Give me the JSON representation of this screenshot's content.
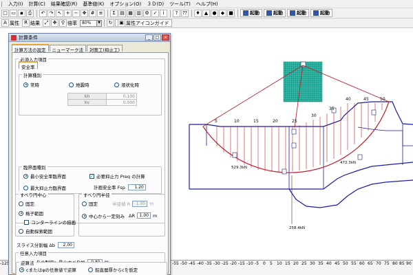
{
  "menubar": {
    "items": [
      "入力(I)",
      "計算(C)",
      "結果確認(R)",
      "基準値(K)",
      "オプション(O)",
      "３Ｄ(D)",
      "ツール(T)",
      "ヘルプ(H)"
    ]
  },
  "toolbar": {
    "launch_buttons": [
      "起動",
      "起動",
      "起動",
      "起動"
    ],
    "attr_label": "属性",
    "result_label": "結果",
    "zoom_label": "倍率",
    "zoom_value": "80%",
    "guide_label": "属性アイコンガイド"
  },
  "dialog": {
    "title": "計算条件",
    "tabs": [
      "計算方法の設定",
      "ニューマーク法",
      "対策工(抑止工)"
    ],
    "required_group": "必須入力項目",
    "safety_tab": "安全率",
    "calc_type_group": "計算種別",
    "calc_types": [
      "常時",
      "地震時",
      "液状化時"
    ],
    "kh_label": "kh",
    "kh_value": "0.100",
    "kv_label": "kv",
    "kv_value": "0.000",
    "critical_group": "臨界面種別",
    "critical_min_sf": "最小安全率臨界面",
    "critical_max_force": "最大抑止力臨界面",
    "need_force_label": "必要抑止力 Preq の計算",
    "plan_sf_label": "計画安全率 Fsp",
    "plan_sf_value": "1.20",
    "slip_center_group": "すべり円中心",
    "center_fixed": "固定",
    "center_grid": "格子範囲",
    "contour_label": "コンターラインの描画",
    "auto_search": "自動探索範囲",
    "slip_radius_group": "すべり円半径",
    "radius_fixed": "固定",
    "radius_value_label": "半径値 R",
    "radius_value": "1.00",
    "radius_unit": "m",
    "radius_from_center": "中心から一定刻み",
    "delta_r_label": "ΔR",
    "delta_r_value": "1.00",
    "delta_r_unit": "m",
    "slice_label": "スライス分割幅 Δb",
    "slice_value": "2.00",
    "optional_group": "任意入力項目",
    "min_slip_depth_label": "表層すべりの制御：最小すべり幅",
    "min_slip_depth_value": "0.80",
    "min_slip_depth_unit": "m",
    "approach_group": "逆算法",
    "approach_opt1": "cまたはφの任意値で逆算",
    "approach_opt2": "鉛直層厚からcを仮定"
  },
  "drawing": {
    "slice_labels": [
      "5",
      "10",
      "15",
      "20",
      "25",
      "30",
      "35",
      "40",
      "45",
      "50"
    ],
    "force_left": "529.3kN",
    "force_right": "472.3kN",
    "force_bottom": "258.4kN"
  },
  "ruler": {
    "left_label": "-125",
    "ticks": [
      "-55",
      "-50",
      "-45",
      "-40",
      "-35",
      "-30",
      "-25",
      "-20",
      "-15",
      "-10",
      "-5",
      "0",
      "5",
      "10",
      "15",
      "20",
      "25",
      "30",
      "35",
      "40",
      "45",
      "50",
      "55",
      "60",
      "65",
      "70",
      "75",
      "80",
      "85",
      "90"
    ]
  },
  "colors": {
    "slip_circle": "#c0202a",
    "ground_line": "#1a1aa8",
    "grid_mesh": "#1a9a8a",
    "grid_fill": "#2fb8a6"
  }
}
